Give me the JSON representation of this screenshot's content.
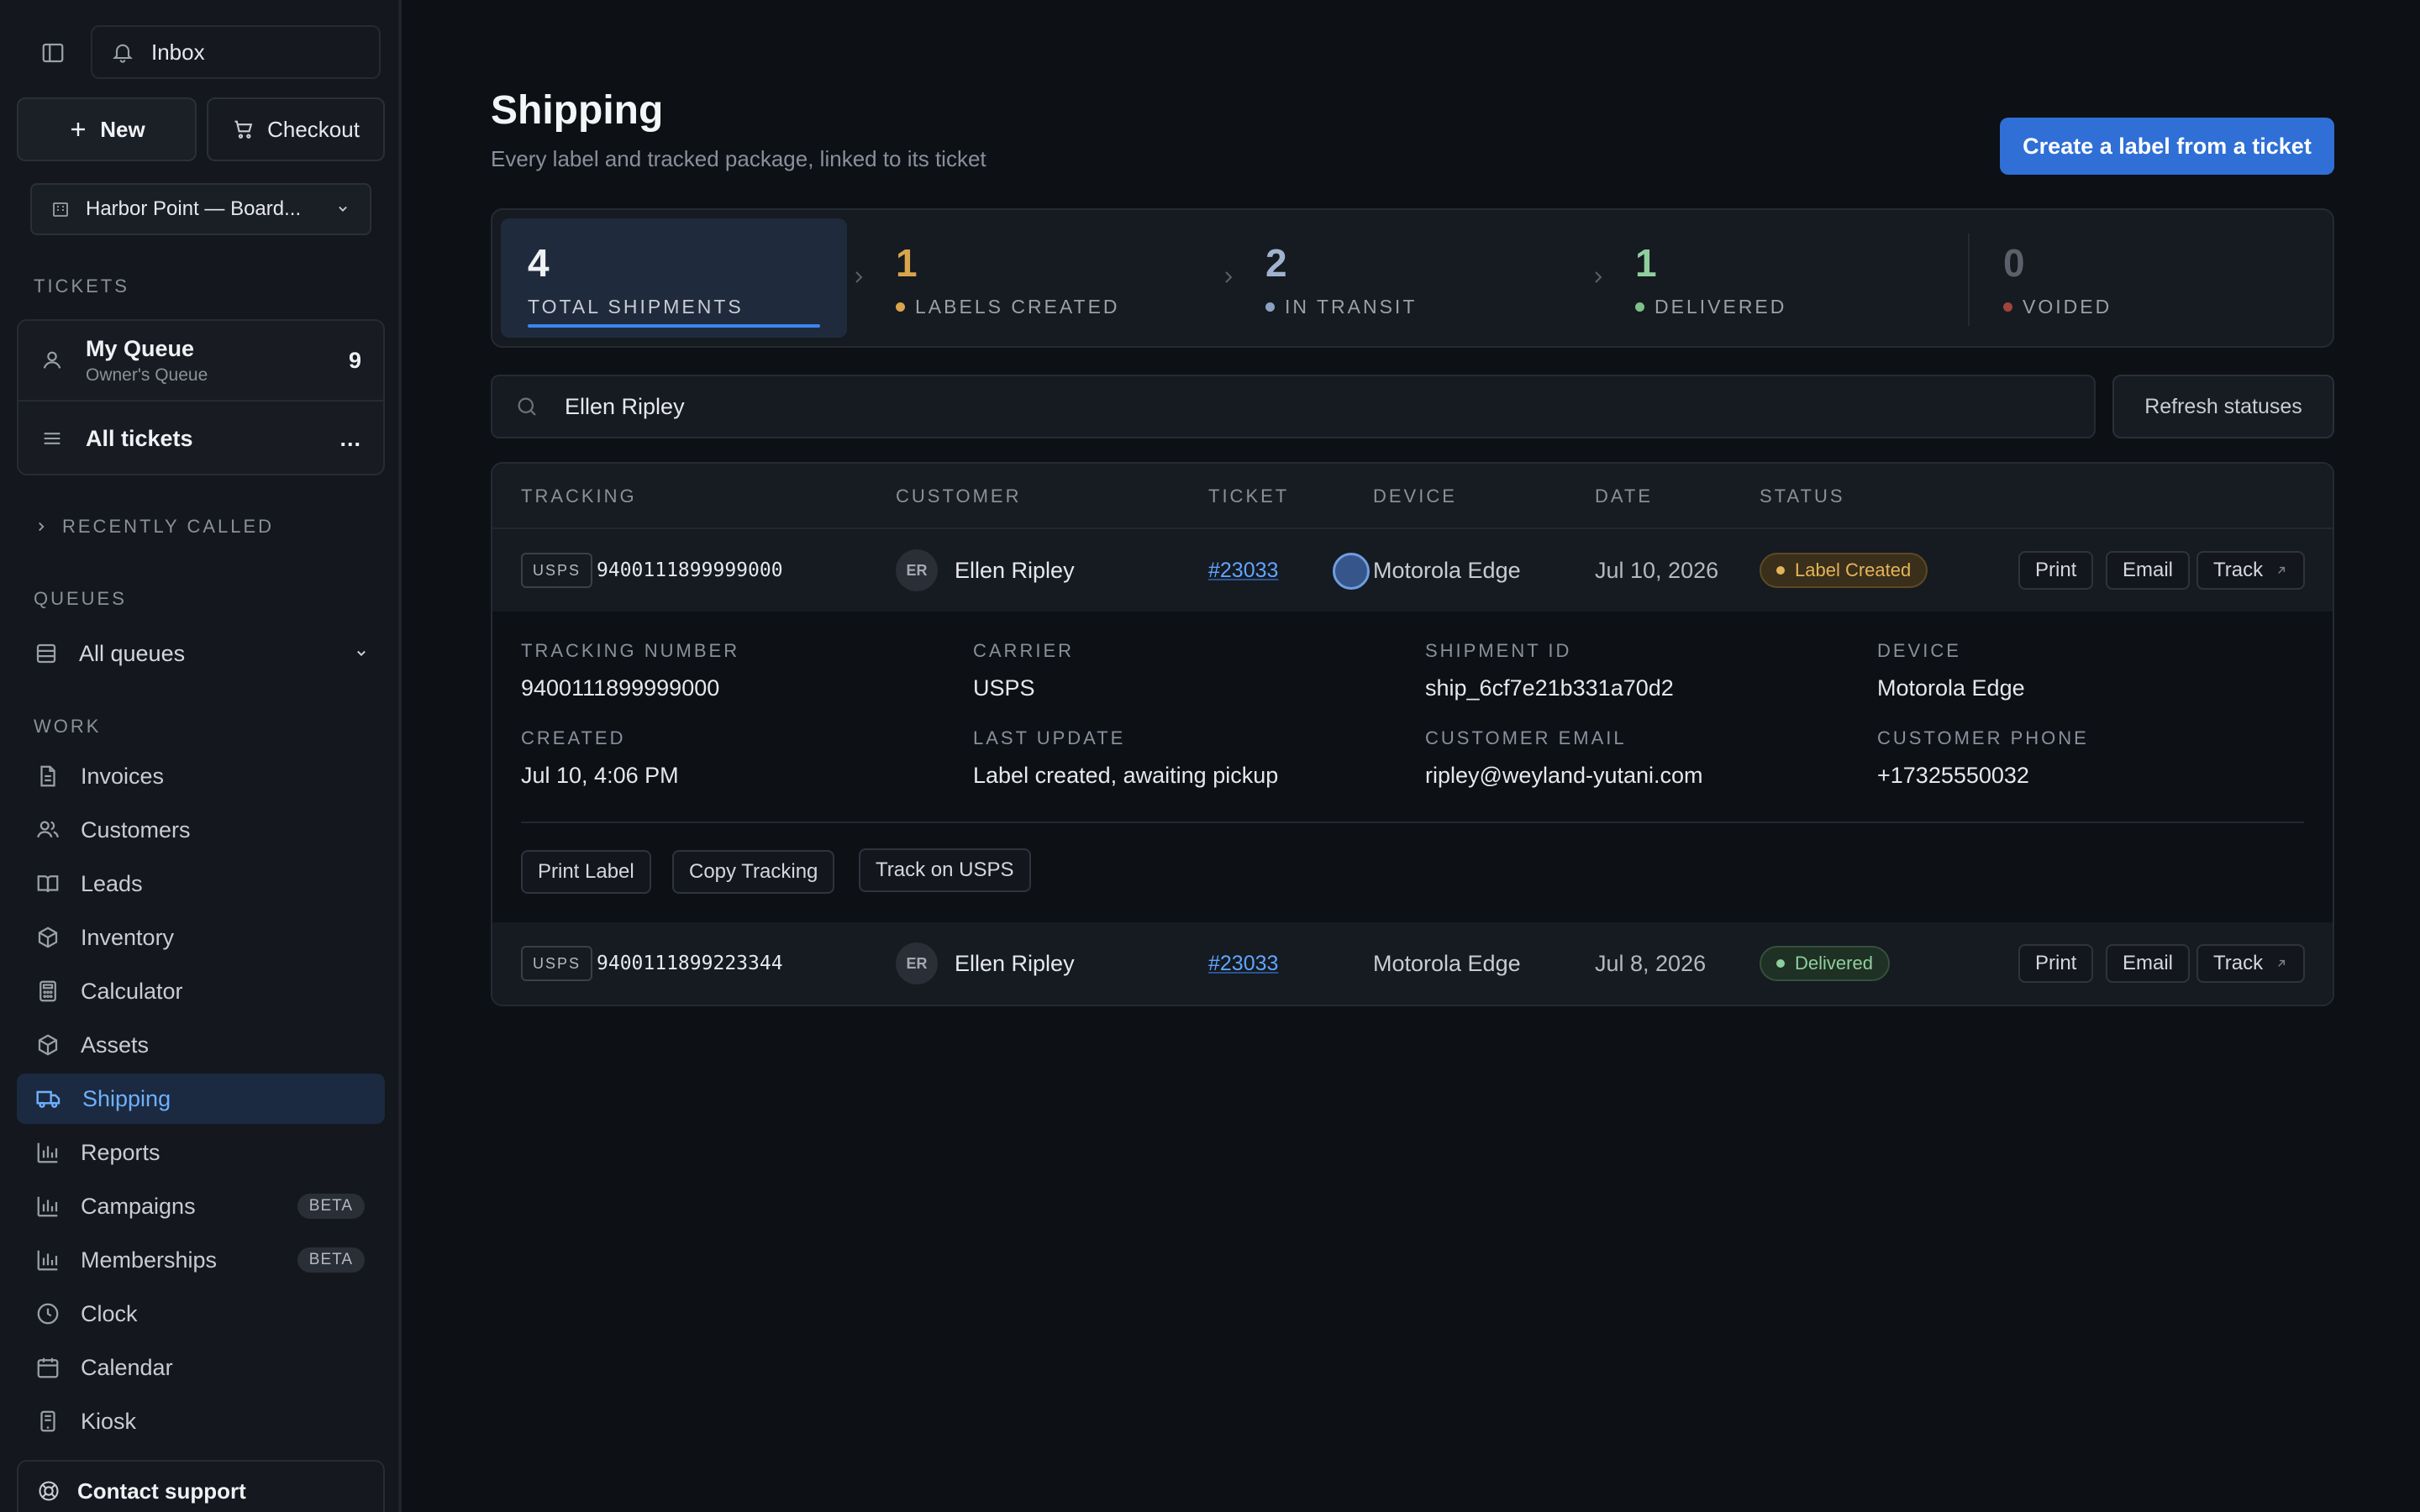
{
  "sidebar": {
    "inbox_label": "Inbox",
    "new_label": "New",
    "checkout_label": "Checkout",
    "store": "Harbor Point — Board...",
    "tickets_section": "TICKETS",
    "my_queue": {
      "title": "My Queue",
      "subtitle": "Owner's Queue",
      "count": "9"
    },
    "all_tickets": {
      "title": "All tickets",
      "more": "..."
    },
    "recently_called": "RECENTLY CALLED",
    "queues_section": "QUEUES",
    "all_queues": "All queues",
    "work_section": "WORK",
    "nav": [
      {
        "label": "Invoices",
        "icon": "file-icon"
      },
      {
        "label": "Customers",
        "icon": "users-icon"
      },
      {
        "label": "Leads",
        "icon": "book-icon"
      },
      {
        "label": "Inventory",
        "icon": "box-icon"
      },
      {
        "label": "Calculator",
        "icon": "calculator-icon"
      },
      {
        "label": "Assets",
        "icon": "box-icon"
      },
      {
        "label": "Shipping",
        "icon": "truck-icon",
        "active": true
      },
      {
        "label": "Reports",
        "icon": "bar-chart-icon"
      },
      {
        "label": "Campaigns",
        "icon": "bar-chart-icon",
        "badge": "BETA"
      },
      {
        "label": "Memberships",
        "icon": "bar-chart-icon",
        "badge": "BETA"
      },
      {
        "label": "Clock",
        "icon": "clock-icon"
      },
      {
        "label": "Calendar",
        "icon": "calendar-icon"
      },
      {
        "label": "Kiosk",
        "icon": "tablet-icon"
      }
    ],
    "support_label": "Contact support"
  },
  "header": {
    "title": "Shipping",
    "subtitle": "Every label and tracked package, linked to its ticket",
    "create_label": "Create a label from a ticket"
  },
  "stats": [
    {
      "value": "4",
      "label": "TOTAL SHIPMENTS",
      "color": "#f0f1f4"
    },
    {
      "value": "1",
      "label": "LABELS CREATED",
      "color": "#d9a54c",
      "dot": "#d9a54c"
    },
    {
      "value": "2",
      "label": "IN TRANSIT",
      "color": "#9fb3cc",
      "dot": "#8aa3c2"
    },
    {
      "value": "1",
      "label": "DELIVERED",
      "color": "#8fcf9d",
      "dot": "#7fbf8a"
    },
    {
      "value": "0",
      "label": "VOIDED",
      "color": "#5b616b",
      "dot": "#a0453d"
    }
  ],
  "search": {
    "value": "Ellen Ripley"
  },
  "refresh_label": "Refresh statuses",
  "table": {
    "headers": [
      "TRACKING",
      "CUSTOMER",
      "TICKET",
      "DEVICE",
      "DATE",
      "STATUS"
    ],
    "rows": [
      {
        "carrier": "USPS",
        "tracking": "9400111899999000",
        "initials": "ER",
        "customer": "Ellen Ripley",
        "ticket": "#23033",
        "device": "Motorola Edge",
        "date": "Jul 10, 2026",
        "status": "Label Created",
        "actions": {
          "print": "Print",
          "email": "Email",
          "track": "Track"
        }
      },
      {
        "carrier": "USPS",
        "tracking": "9400111899223344",
        "initials": "ER",
        "customer": "Ellen Ripley",
        "ticket": "#23033",
        "device": "Motorola Edge",
        "date": "Jul 8, 2026",
        "status": "Delivered",
        "actions": {
          "print": "Print",
          "email": "Email",
          "track": "Track"
        }
      }
    ],
    "detail": {
      "tracking_number_label": "TRACKING NUMBER",
      "tracking_number": "9400111899999000",
      "carrier_label": "CARRIER",
      "carrier": "USPS",
      "shipment_id_label": "SHIPMENT ID",
      "shipment_id": "ship_6cf7e21b331a70d2",
      "device_label": "DEVICE",
      "device": "Motorola Edge",
      "created_label": "CREATED",
      "created": "Jul 10, 4:06 PM",
      "last_update_label": "LAST UPDATE",
      "last_update": "Label created, awaiting pickup",
      "email_label": "CUSTOMER EMAIL",
      "email": "ripley@weyland-yutani.com",
      "phone_label": "CUSTOMER PHONE",
      "phone": "+17325550032",
      "print_label": "Print Label",
      "copy_tracking": "Copy Tracking",
      "track_on": "Track on USPS"
    }
  }
}
